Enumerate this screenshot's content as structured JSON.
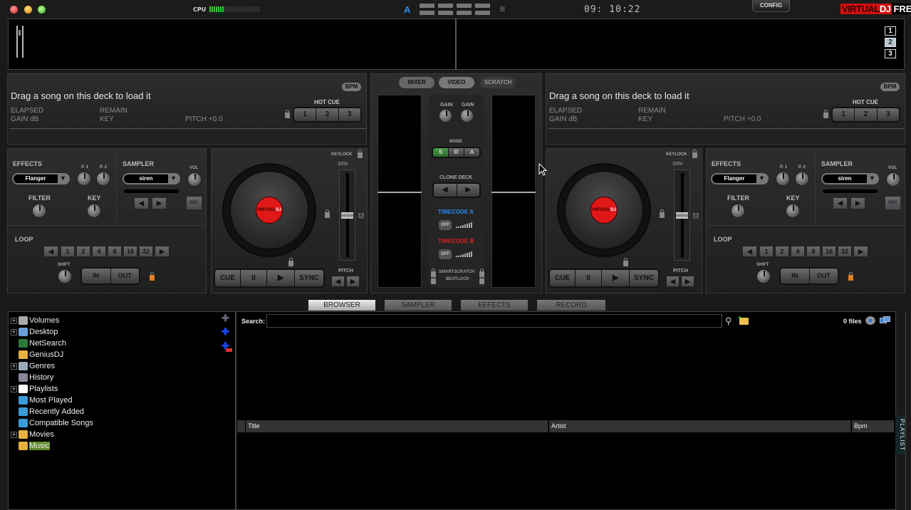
{
  "app": {
    "logo_main": "VIRTUAL",
    "logo_dj": "DJ",
    "logo_edition": "FREE",
    "clock": "09: 10:22",
    "config_label": "CONFIG",
    "cpu_label": "CPU",
    "cpu_active_bars": 7,
    "cpu_total_bars": 24
  },
  "crossfader": {
    "a_label": "A",
    "b_label": "B"
  },
  "window_controls": {
    "close_color": "#e04040",
    "minimize_color": "#f0a020",
    "zoom_color": "#50c030"
  },
  "video_screens": [
    "1",
    "2",
    "3"
  ],
  "video_selected": "2",
  "decks": [
    {
      "id": "left",
      "message": "Drag a song on this deck to load it",
      "elapsed": "ELAPSED",
      "remain": "REMAIN",
      "gain": "GAIN dB",
      "key": "KEY",
      "pitch": "PITCH +0.0",
      "bpm_label": "BPM",
      "hot_cue_label": "HOT CUE",
      "hot_cues": [
        "1",
        "2",
        "3"
      ],
      "effects_label": "EFFECTS",
      "effect": "Flanger",
      "p1": "P. 1",
      "p2": "P. 2",
      "filter": "FILTER",
      "key_knob": "KEY",
      "sampler_label": "SAMPLER",
      "sample": "siren",
      "vol": "VOL",
      "rec": "REC",
      "loop_label": "LOOP",
      "loop_sizes": [
        "1",
        "2",
        "4",
        "8",
        "16",
        "32"
      ],
      "shift": "SHIFT",
      "loop_in": "IN",
      "loop_out": "OUT",
      "keylock": "KEYLOCK",
      "pitch_range": "33%",
      "pitch_zero": "0",
      "pitch_label": "PITCH",
      "platter_label_a": "VIRTUAL",
      "platter_label_b": "DJ",
      "transport": [
        "CUE",
        "II",
        "▶",
        "SYNC"
      ]
    },
    {
      "id": "right",
      "message": "Drag a song on this deck to load it",
      "elapsed": "ELAPSED",
      "remain": "REMAIN",
      "gain": "GAIN dB",
      "key": "KEY",
      "pitch": "PITCH +0.0",
      "bpm_label": "BPM",
      "hot_cue_label": "HOT CUE",
      "hot_cues": [
        "1",
        "2",
        "3"
      ],
      "effects_label": "EFFECTS",
      "effect": "Flanger",
      "p1": "P. 1",
      "p2": "P. 2",
      "filter": "FILTER",
      "key_knob": "KEY",
      "sampler_label": "SAMPLER",
      "sample": "siren",
      "vol": "VOL",
      "rec": "REC",
      "loop_label": "LOOP",
      "loop_sizes": [
        "1",
        "2",
        "4",
        "8",
        "16",
        "32"
      ],
      "shift": "SHIFT",
      "loop_in": "IN",
      "loop_out": "OUT",
      "keylock": "KEYLOCK",
      "pitch_range": "33%",
      "pitch_zero": "0",
      "pitch_label": "PITCH",
      "platter_label_a": "VIRTUAL",
      "platter_label_b": "DJ",
      "transport": [
        "CUE",
        "II",
        "▶",
        "SYNC"
      ]
    }
  ],
  "mixer": {
    "tabs": [
      "MIXER",
      "VIDEO",
      "SCRATCH"
    ],
    "active_tab": "VIDEO",
    "gain1": "GAIN",
    "gain2": "GAIN",
    "mode_label": "MODE",
    "modes": [
      "S",
      "R",
      "A"
    ],
    "active_mode": "S",
    "clone_deck": "CLONE DECK",
    "timecode_a": "TIMECODE A",
    "timecode_b": "TIMECODE B",
    "off": "OFF",
    "smartscratch": "SMARTSCRATCH",
    "beatlock": "BEATLOCK",
    "timecode_a_color": "#2a8cf0",
    "timecode_b_color": "#e02020"
  },
  "bottom_tabs": [
    "BROWSER",
    "SAMPLER",
    "EFFECTS",
    "RECORD"
  ],
  "active_bottom_tab": "BROWSER",
  "tree": [
    {
      "label": "Volumes",
      "expandable": true,
      "icon": "drive-icon",
      "color": "#aaa"
    },
    {
      "label": "Desktop",
      "expandable": true,
      "icon": "desktop-icon",
      "color": "#6aa0d8"
    },
    {
      "label": "NetSearch",
      "expandable": false,
      "icon": "globe-icon",
      "color": "#2a7a3a"
    },
    {
      "label": "GeniusDJ",
      "expandable": false,
      "icon": "genius-folder-icon",
      "color": "#e8b040"
    },
    {
      "label": "Genres",
      "expandable": true,
      "icon": "genres-icon",
      "color": "#9ab"
    },
    {
      "label": "History",
      "expandable": false,
      "icon": "history-icon",
      "color": "#889"
    },
    {
      "label": "Playlists",
      "expandable": true,
      "icon": "playlist-file-icon",
      "color": "#fff"
    },
    {
      "label": "Most Played",
      "expandable": false,
      "icon": "filter-folder-icon",
      "color": "#3a9ad8"
    },
    {
      "label": "Recently Added",
      "expandable": false,
      "icon": "filter-folder-icon",
      "color": "#3a9ad8"
    },
    {
      "label": "Compatible Songs",
      "expandable": false,
      "icon": "filter-folder-icon",
      "color": "#3a9ad8"
    },
    {
      "label": "Movies",
      "expandable": true,
      "icon": "favorite-folder-icon",
      "color": "#e8b040"
    },
    {
      "label": "Music",
      "expandable": false,
      "icon": "favorite-folder-icon",
      "color": "#e8b040",
      "selected": true
    }
  ],
  "browser": {
    "search_label": "Search:",
    "search_value": "",
    "file_count": "0 files",
    "columns": [
      "Title",
      "Artist",
      "Bpm"
    ],
    "side_tab": "PLAYLIST"
  }
}
